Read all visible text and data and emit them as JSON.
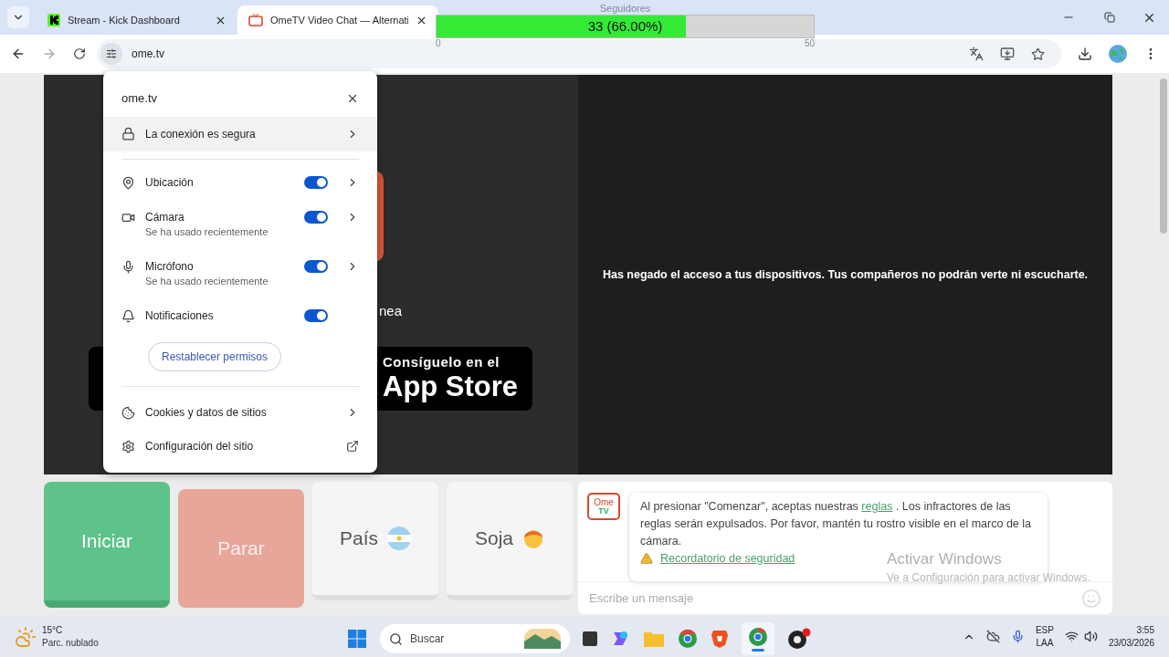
{
  "browser": {
    "tabs": [
      {
        "title": "Stream - Kick Dashboard",
        "selected": false,
        "kind": "kick"
      },
      {
        "title": "OmeTV Video Chat — Alternati",
        "selected": true,
        "kind": "ome"
      }
    ],
    "address": "ome.tv"
  },
  "overlay": {
    "label": "Seguidores",
    "reading": "33 (66.00%)",
    "level": 0.66,
    "min": "0",
    "max": "50"
  },
  "popup": {
    "title": "ome.tv",
    "items": [
      {
        "kind": "link",
        "label": "La conexión es segura"
      },
      {
        "kind": "permission",
        "label": "Ubicación",
        "on": true,
        "arrow": true
      },
      {
        "kind": "permission",
        "label": "Cámara",
        "note": "Se ha usado recientemente",
        "on": true,
        "arrow": true
      },
      {
        "kind": "permission",
        "label": "Micrófono",
        "note": "Se ha usado recientemente",
        "on": true,
        "arrow": true
      },
      {
        "kind": "permission",
        "label": "Notificaciones",
        "on": true,
        "arrow": false
      },
      {
        "kind": "button",
        "label": "Restablecer permisos"
      },
      {
        "kind": "link",
        "label": "Cookies y datos de sitios"
      },
      {
        "kind": "external",
        "label": "Configuración del sitio"
      }
    ]
  },
  "video": {
    "partial_text": "nea",
    "store_line1": "Consíguelo en el",
    "store_line2": "App Store",
    "message": "Has negado el acceso a tus dispositivos. Tus compañeros no podrán verte ni escucharte."
  },
  "controls": [
    {
      "label": "Iniciar",
      "kind": "start"
    },
    {
      "label": "Parar",
      "kind": "stop"
    },
    {
      "label": "País",
      "kind": "country"
    },
    {
      "label": "Soja",
      "kind": "gender"
    }
  ],
  "chat": {
    "notice_before": "Al presionar \"Comenzar\", aceptas nuestras ",
    "notice_link": "reglas",
    "notice_after": " . Los infractores de las reglas serán expulsados. Por favor, mantén tu rostro visible en el marco de la cámara.",
    "safety_link": "Recordatorio de seguridad",
    "placeholder": "Escribe un mensaje",
    "logo_top": "Ome",
    "logo_bottom": "TV"
  },
  "windows_notice": {
    "title": "Activar Windows",
    "subtitle": "Ve a Configuración para activar Windows."
  },
  "taskbar": {
    "temperature": "15°C",
    "weather": "Parc. nublado",
    "search": "Buscar",
    "language": "ESP",
    "layout": "LAA",
    "time": "3:55",
    "date": "23/03/2026"
  }
}
